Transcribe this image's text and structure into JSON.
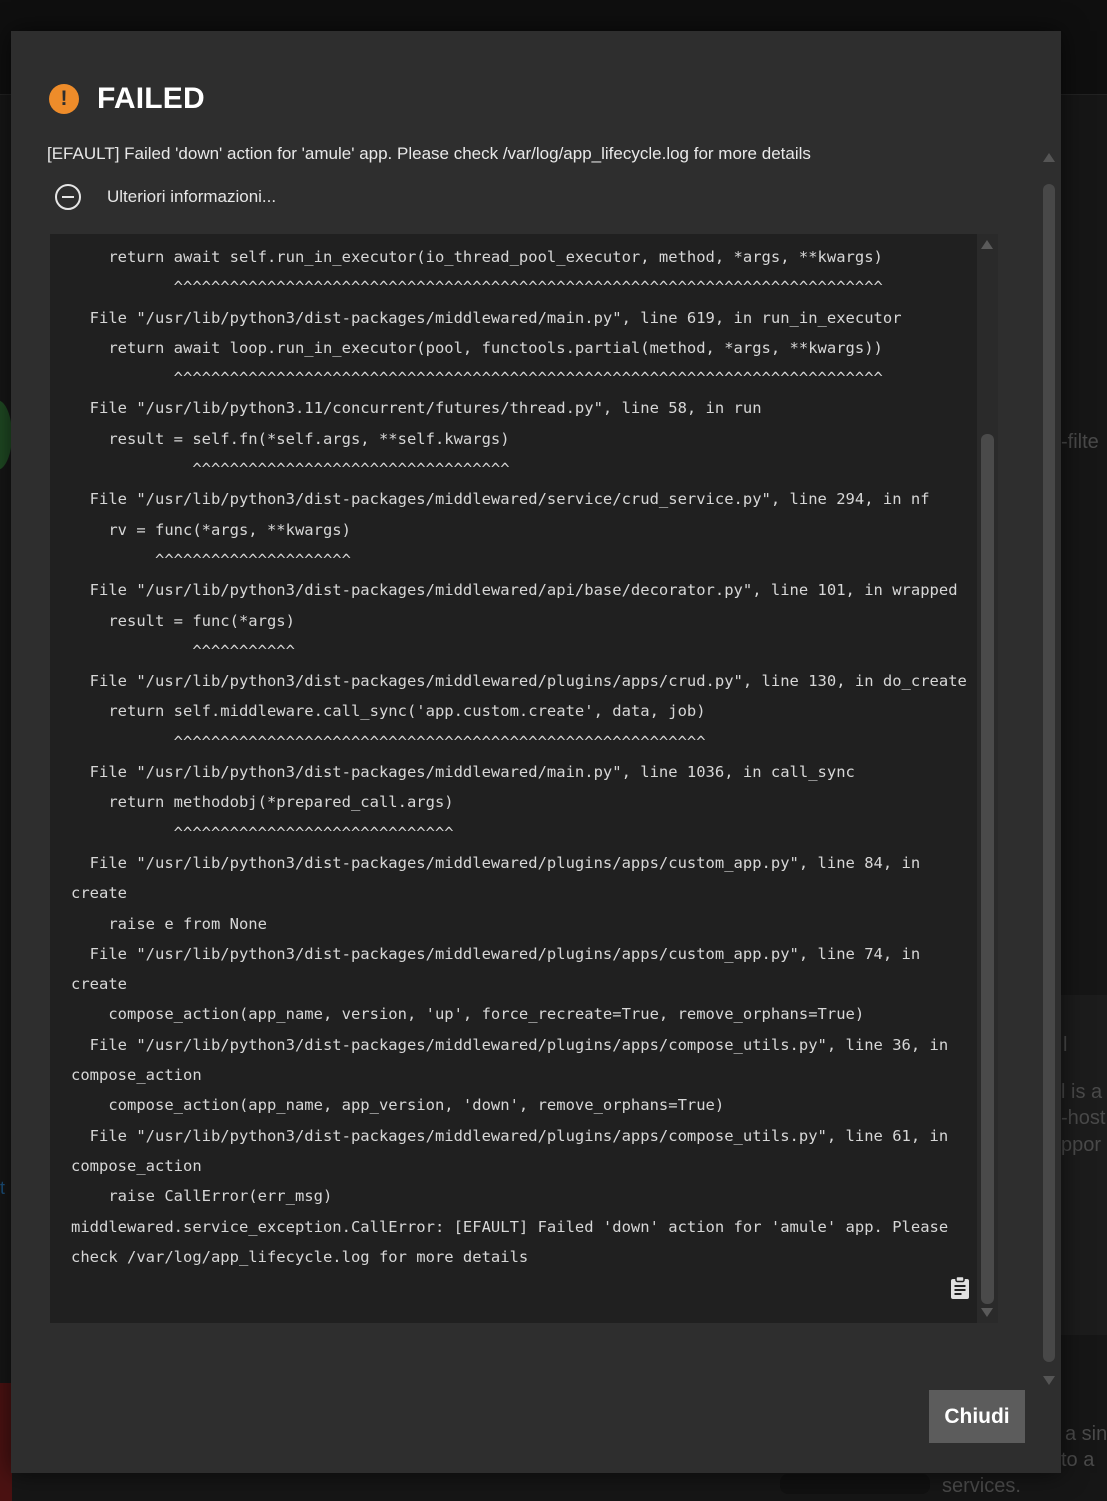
{
  "background": {
    "fragments": [
      "-filte",
      "l",
      "l is a",
      "-host",
      "ppor",
      "a sin",
      "to a",
      "services.",
      "t"
    ]
  },
  "dialog": {
    "title": "FAILED",
    "icon": "warning-icon",
    "message": "[EFAULT] Failed 'down' action for 'amule' app. Please check /var/log/app_lifecycle.log for more details",
    "more_info_label": "Ulteriori informazioni...",
    "traceback": [
      "    return await self.run_in_executor(io_thread_pool_executor, method, *args, **kwargs)",
      "           ^^^^^^^^^^^^^^^^^^^^^^^^^^^^^^^^^^^^^^^^^^^^^^^^^^^^^^^^^^^^^^^^^^^^^^^^^^^^",
      "  File \"/usr/lib/python3/dist-packages/middlewared/main.py\", line 619, in run_in_executor",
      "    return await loop.run_in_executor(pool, functools.partial(method, *args, **kwargs))",
      "           ^^^^^^^^^^^^^^^^^^^^^^^^^^^^^^^^^^^^^^^^^^^^^^^^^^^^^^^^^^^^^^^^^^^^^^^^^^^^",
      "  File \"/usr/lib/python3.11/concurrent/futures/thread.py\", line 58, in run",
      "    result = self.fn(*self.args, **self.kwargs)",
      "             ^^^^^^^^^^^^^^^^^^^^^^^^^^^^^^^^^^",
      "  File \"/usr/lib/python3/dist-packages/middlewared/service/crud_service.py\", line 294, in nf",
      "    rv = func(*args, **kwargs)",
      "         ^^^^^^^^^^^^^^^^^^^^^",
      "  File \"/usr/lib/python3/dist-packages/middlewared/api/base/decorator.py\", line 101, in wrapped",
      "    result = func(*args)",
      "             ^^^^^^^^^^^",
      "  File \"/usr/lib/python3/dist-packages/middlewared/plugins/apps/crud.py\", line 130, in do_create",
      "    return self.middleware.call_sync('app.custom.create', data, job)",
      "           ^^^^^^^^^^^^^^^^^^^^^^^^^^^^^^^^^^^^^^^^^^^^^^^^^^^^^^^^^",
      "  File \"/usr/lib/python3/dist-packages/middlewared/main.py\", line 1036, in call_sync",
      "    return methodobj(*prepared_call.args)",
      "           ^^^^^^^^^^^^^^^^^^^^^^^^^^^^^^",
      "  File \"/usr/lib/python3/dist-packages/middlewared/plugins/apps/custom_app.py\", line 84, in",
      "create",
      "    raise e from None",
      "  File \"/usr/lib/python3/dist-packages/middlewared/plugins/apps/custom_app.py\", line 74, in",
      "create",
      "    compose_action(app_name, version, 'up', force_recreate=True, remove_orphans=True)",
      "  File \"/usr/lib/python3/dist-packages/middlewared/plugins/apps/compose_utils.py\", line 36, in",
      "compose_action",
      "    compose_action(app_name, app_version, 'down', remove_orphans=True)",
      "  File \"/usr/lib/python3/dist-packages/middlewared/plugins/apps/compose_utils.py\", line 61, in",
      "compose_action",
      "    raise CallError(err_msg)",
      "middlewared.service_exception.CallError: [EFAULT] Failed 'down' action for 'amule' app. Please",
      "check /var/log/app_lifecycle.log for more details"
    ],
    "copy_icon": "clipboard-icon",
    "close_label": "Chiudi"
  },
  "colors": {
    "dialog_bg": "#2e2e2e",
    "trace_bg": "#202020",
    "warning": "#ee8c2a",
    "button_bg": "#5c5c5c"
  }
}
